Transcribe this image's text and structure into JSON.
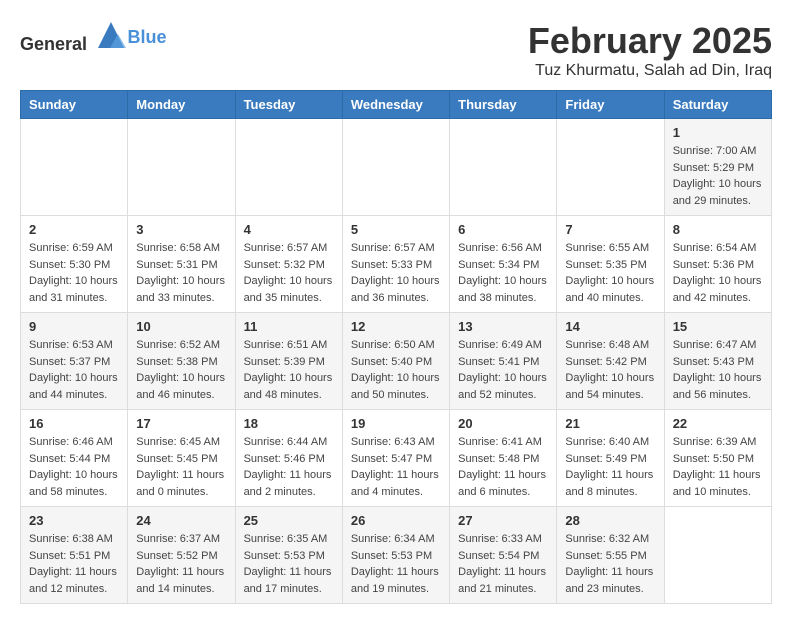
{
  "logo": {
    "general": "General",
    "blue": "Blue"
  },
  "header": {
    "month_year": "February 2025",
    "location": "Tuz Khurmatu, Salah ad Din, Iraq"
  },
  "weekdays": [
    "Sunday",
    "Monday",
    "Tuesday",
    "Wednesday",
    "Thursday",
    "Friday",
    "Saturday"
  ],
  "weeks": [
    [
      {
        "day": "",
        "info": ""
      },
      {
        "day": "",
        "info": ""
      },
      {
        "day": "",
        "info": ""
      },
      {
        "day": "",
        "info": ""
      },
      {
        "day": "",
        "info": ""
      },
      {
        "day": "",
        "info": ""
      },
      {
        "day": "1",
        "info": "Sunrise: 7:00 AM\nSunset: 5:29 PM\nDaylight: 10 hours and 29 minutes."
      }
    ],
    [
      {
        "day": "2",
        "info": "Sunrise: 6:59 AM\nSunset: 5:30 PM\nDaylight: 10 hours and 31 minutes."
      },
      {
        "day": "3",
        "info": "Sunrise: 6:58 AM\nSunset: 5:31 PM\nDaylight: 10 hours and 33 minutes."
      },
      {
        "day": "4",
        "info": "Sunrise: 6:57 AM\nSunset: 5:32 PM\nDaylight: 10 hours and 35 minutes."
      },
      {
        "day": "5",
        "info": "Sunrise: 6:57 AM\nSunset: 5:33 PM\nDaylight: 10 hours and 36 minutes."
      },
      {
        "day": "6",
        "info": "Sunrise: 6:56 AM\nSunset: 5:34 PM\nDaylight: 10 hours and 38 minutes."
      },
      {
        "day": "7",
        "info": "Sunrise: 6:55 AM\nSunset: 5:35 PM\nDaylight: 10 hours and 40 minutes."
      },
      {
        "day": "8",
        "info": "Sunrise: 6:54 AM\nSunset: 5:36 PM\nDaylight: 10 hours and 42 minutes."
      }
    ],
    [
      {
        "day": "9",
        "info": "Sunrise: 6:53 AM\nSunset: 5:37 PM\nDaylight: 10 hours and 44 minutes."
      },
      {
        "day": "10",
        "info": "Sunrise: 6:52 AM\nSunset: 5:38 PM\nDaylight: 10 hours and 46 minutes."
      },
      {
        "day": "11",
        "info": "Sunrise: 6:51 AM\nSunset: 5:39 PM\nDaylight: 10 hours and 48 minutes."
      },
      {
        "day": "12",
        "info": "Sunrise: 6:50 AM\nSunset: 5:40 PM\nDaylight: 10 hours and 50 minutes."
      },
      {
        "day": "13",
        "info": "Sunrise: 6:49 AM\nSunset: 5:41 PM\nDaylight: 10 hours and 52 minutes."
      },
      {
        "day": "14",
        "info": "Sunrise: 6:48 AM\nSunset: 5:42 PM\nDaylight: 10 hours and 54 minutes."
      },
      {
        "day": "15",
        "info": "Sunrise: 6:47 AM\nSunset: 5:43 PM\nDaylight: 10 hours and 56 minutes."
      }
    ],
    [
      {
        "day": "16",
        "info": "Sunrise: 6:46 AM\nSunset: 5:44 PM\nDaylight: 10 hours and 58 minutes."
      },
      {
        "day": "17",
        "info": "Sunrise: 6:45 AM\nSunset: 5:45 PM\nDaylight: 11 hours and 0 minutes."
      },
      {
        "day": "18",
        "info": "Sunrise: 6:44 AM\nSunset: 5:46 PM\nDaylight: 11 hours and 2 minutes."
      },
      {
        "day": "19",
        "info": "Sunrise: 6:43 AM\nSunset: 5:47 PM\nDaylight: 11 hours and 4 minutes."
      },
      {
        "day": "20",
        "info": "Sunrise: 6:41 AM\nSunset: 5:48 PM\nDaylight: 11 hours and 6 minutes."
      },
      {
        "day": "21",
        "info": "Sunrise: 6:40 AM\nSunset: 5:49 PM\nDaylight: 11 hours and 8 minutes."
      },
      {
        "day": "22",
        "info": "Sunrise: 6:39 AM\nSunset: 5:50 PM\nDaylight: 11 hours and 10 minutes."
      }
    ],
    [
      {
        "day": "23",
        "info": "Sunrise: 6:38 AM\nSunset: 5:51 PM\nDaylight: 11 hours and 12 minutes."
      },
      {
        "day": "24",
        "info": "Sunrise: 6:37 AM\nSunset: 5:52 PM\nDaylight: 11 hours and 14 minutes."
      },
      {
        "day": "25",
        "info": "Sunrise: 6:35 AM\nSunset: 5:53 PM\nDaylight: 11 hours and 17 minutes."
      },
      {
        "day": "26",
        "info": "Sunrise: 6:34 AM\nSunset: 5:53 PM\nDaylight: 11 hours and 19 minutes."
      },
      {
        "day": "27",
        "info": "Sunrise: 6:33 AM\nSunset: 5:54 PM\nDaylight: 11 hours and 21 minutes."
      },
      {
        "day": "28",
        "info": "Sunrise: 6:32 AM\nSunset: 5:55 PM\nDaylight: 11 hours and 23 minutes."
      },
      {
        "day": "",
        "info": ""
      }
    ]
  ]
}
